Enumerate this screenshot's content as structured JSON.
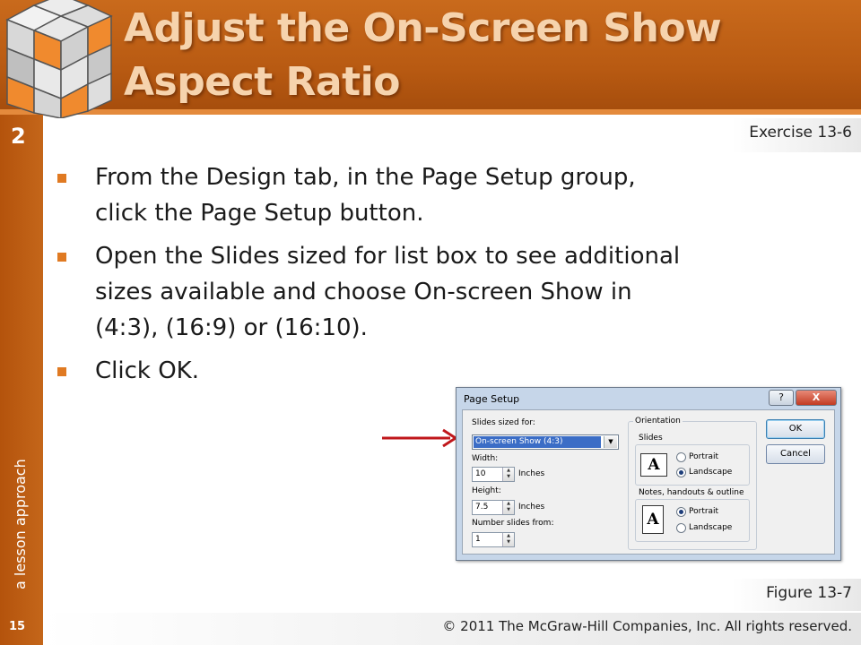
{
  "header": {
    "title": "Adjust the On-Screen Show Aspect Ratio"
  },
  "sidebar": {
    "lesson_number": "2",
    "tagline": "a lesson approach",
    "page_number": "15"
  },
  "exercise_label": "Exercise 13-6",
  "figure_label": "Figure 13-7",
  "copyright": "© 2011 The McGraw-Hill Companies, Inc. All rights reserved.",
  "bullets": [
    "From the Design tab, in the Page Setup group, click the Page Setup button.",
    "Open the Slides sized for list box to see additional sizes available and choose On-screen Show in (4:3), (16:9) or (16:10).",
    "Click OK."
  ],
  "dialog": {
    "title": "Page Setup",
    "help_label": "?",
    "close_label": "X",
    "slides_sized_for_label": "Slides sized for:",
    "slides_sized_for_value": "On-screen Show (4:3)",
    "width_label": "Width:",
    "width_value": "10",
    "width_unit": "Inches",
    "height_label": "Height:",
    "height_value": "7.5",
    "height_unit": "Inches",
    "number_slides_label": "Number slides from:",
    "number_slides_value": "1",
    "orientation_label": "Orientation",
    "slides_group_label": "Slides",
    "notes_group_label": "Notes, handouts & outline",
    "portrait_label": "Portrait",
    "landscape_label": "Landscape",
    "slides_orientation": "Landscape",
    "notes_orientation": "Portrait",
    "page_icon_glyph": "A",
    "ok_label": "OK",
    "cancel_label": "Cancel"
  },
  "colors": {
    "header": "#b85a12",
    "title_text": "#f6d3ad",
    "sidebar": "#b4530c",
    "bullet": "#e07a22",
    "arrow": "#c0171b"
  }
}
